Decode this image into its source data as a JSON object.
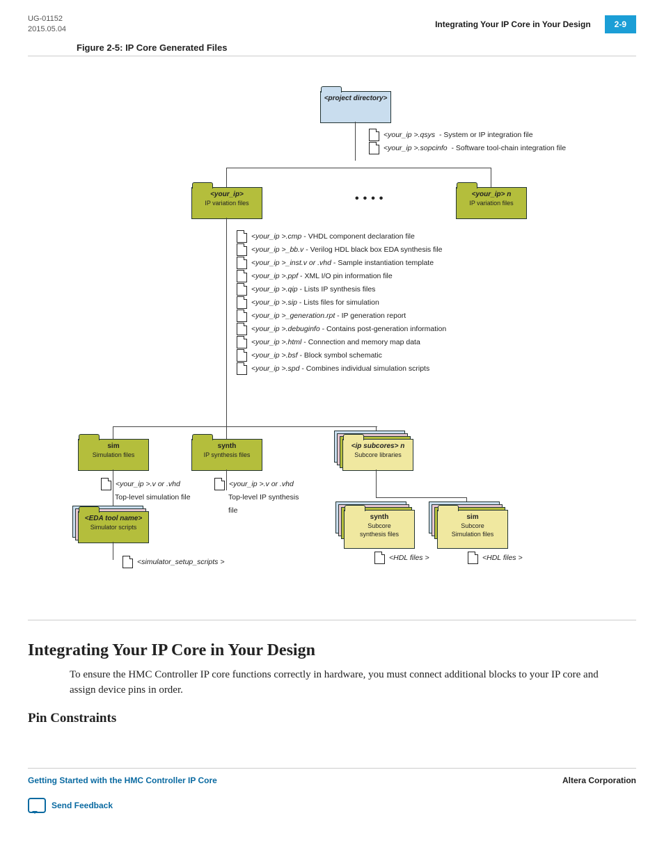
{
  "header": {
    "doc_id": "UG-01152",
    "date": "2015.05.04",
    "section_title": "Integrating Your IP Core in Your Design",
    "page_number": "2-9"
  },
  "figure_caption": "Figure 2-5: IP Core Generated Files",
  "diagram": {
    "project_dir": "<project directory>",
    "project_files": [
      {
        "name": "<your_ip >.qsys",
        "desc": "- System or IP integration file"
      },
      {
        "name": "<your_ip >.sopcinfo",
        "desc": "- Software tool-chain integration file"
      }
    ],
    "your_ip": {
      "label": "<your_ip>",
      "sub": "IP variation files"
    },
    "your_ip_n": {
      "label": "<your_ip> n",
      "sub": "IP variation files"
    },
    "ip_files": [
      {
        "name": "<your_ip >.cmp",
        "desc": "- VHDL component declaration file"
      },
      {
        "name": "<your_ip >_bb.v",
        "desc": "- Verilog HDL black box EDA synthesis file"
      },
      {
        "name": "<your_ip >_inst.v  or  .vhd",
        "desc": "- Sample instantiation template"
      },
      {
        "name": "<your_ip >.ppf",
        "desc": "- XML I/O pin information file"
      },
      {
        "name": "<your_ip >.qip",
        "desc": "- Lists IP synthesis files"
      },
      {
        "name": "<your_ip >.sip",
        "desc": "- Lists files for simulation"
      },
      {
        "name": "<your_ip >_generation.rpt",
        "desc": "- IP generation report"
      },
      {
        "name": "<your_ip >.debuginfo",
        "desc": "- Contains post-generation information"
      },
      {
        "name": "<your_ip >.html",
        "desc": "- Connection and memory map data"
      },
      {
        "name": "<your_ip >.bsf",
        "desc": "- Block symbol schematic"
      },
      {
        "name": "<your_ip >.spd",
        "desc": "- Combines individual simulation scripts"
      }
    ],
    "sim": {
      "label": "sim",
      "sub": "Simulation files"
    },
    "synth": {
      "label": "synth",
      "sub": "IP synthesis files"
    },
    "subcores": {
      "label": "<ip subcores> n",
      "sub": "Subcore libraries"
    },
    "sim_file": {
      "name": "<your_ip >.v or  .vhd",
      "desc": "Top-level simulation file"
    },
    "synth_file": {
      "name": "<your_ip >.v or  .vhd",
      "desc": "Top-level IP synthesis file"
    },
    "eda": {
      "label": "<EDA tool name>",
      "sub": "Simulator scripts"
    },
    "eda_file": "<simulator_setup_scripts   >",
    "sub_synth": {
      "label": "synth",
      "sub1": "Subcore",
      "sub2": "synthesis files"
    },
    "sub_sim": {
      "label": "sim",
      "sub1": "Subcore",
      "sub2": "Simulation files"
    },
    "hdl": "<HDL files   >"
  },
  "section_heading": "Integrating Your IP Core in Your Design",
  "body_para": "To ensure the HMC Controller IP core functions correctly in hardware, you must connect additional blocks to your IP core and assign device pins in order.",
  "subheading": "Pin Constraints",
  "footer": {
    "left": "Getting Started with the HMC Controller IP Core",
    "right": "Altera Corporation",
    "feedback": "Send Feedback"
  }
}
